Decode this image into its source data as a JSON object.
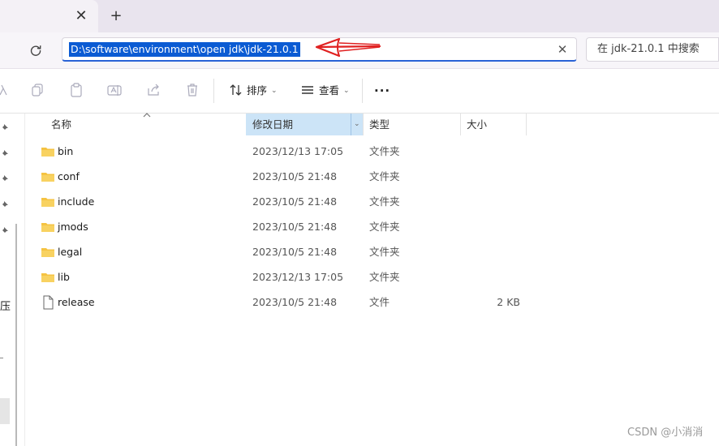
{
  "tab": {
    "close_glyph": "✕",
    "new_tab_glyph": "+"
  },
  "address": {
    "path": "D:\\software\\environment\\open jdk\\jdk-21.0.1",
    "clear_glyph": "✕"
  },
  "search": {
    "placeholder": "在 jdk-21.0.1 中搜索"
  },
  "toolbar": {
    "sort_label": "排序",
    "view_label": "查看",
    "more_label": "···"
  },
  "nav": {
    "fragment": "压"
  },
  "columns": {
    "name": "名称",
    "date": "修改日期",
    "type": "类型",
    "size": "大小"
  },
  "files": [
    {
      "name": "bin",
      "date": "2023/12/13 17:05",
      "type": "文件夹",
      "size": "",
      "icon": "folder-icon"
    },
    {
      "name": "conf",
      "date": "2023/10/5 21:48",
      "type": "文件夹",
      "size": "",
      "icon": "folder-icon"
    },
    {
      "name": "include",
      "date": "2023/10/5 21:48",
      "type": "文件夹",
      "size": "",
      "icon": "folder-icon"
    },
    {
      "name": "jmods",
      "date": "2023/10/5 21:48",
      "type": "文件夹",
      "size": "",
      "icon": "folder-icon"
    },
    {
      "name": "legal",
      "date": "2023/10/5 21:48",
      "type": "文件夹",
      "size": "",
      "icon": "folder-icon"
    },
    {
      "name": "lib",
      "date": "2023/12/13 17:05",
      "type": "文件夹",
      "size": "",
      "icon": "folder-icon"
    },
    {
      "name": "release",
      "date": "2023/10/5 21:48",
      "type": "文件",
      "size": "2 KB",
      "icon": "file-icon"
    }
  ],
  "watermark": "CSDN @小消消",
  "colors": {
    "accent": "#0b5bd3",
    "annotation_arrow": "#e02020",
    "folder": "#f5c342",
    "header_selected": "#cce4f7"
  }
}
